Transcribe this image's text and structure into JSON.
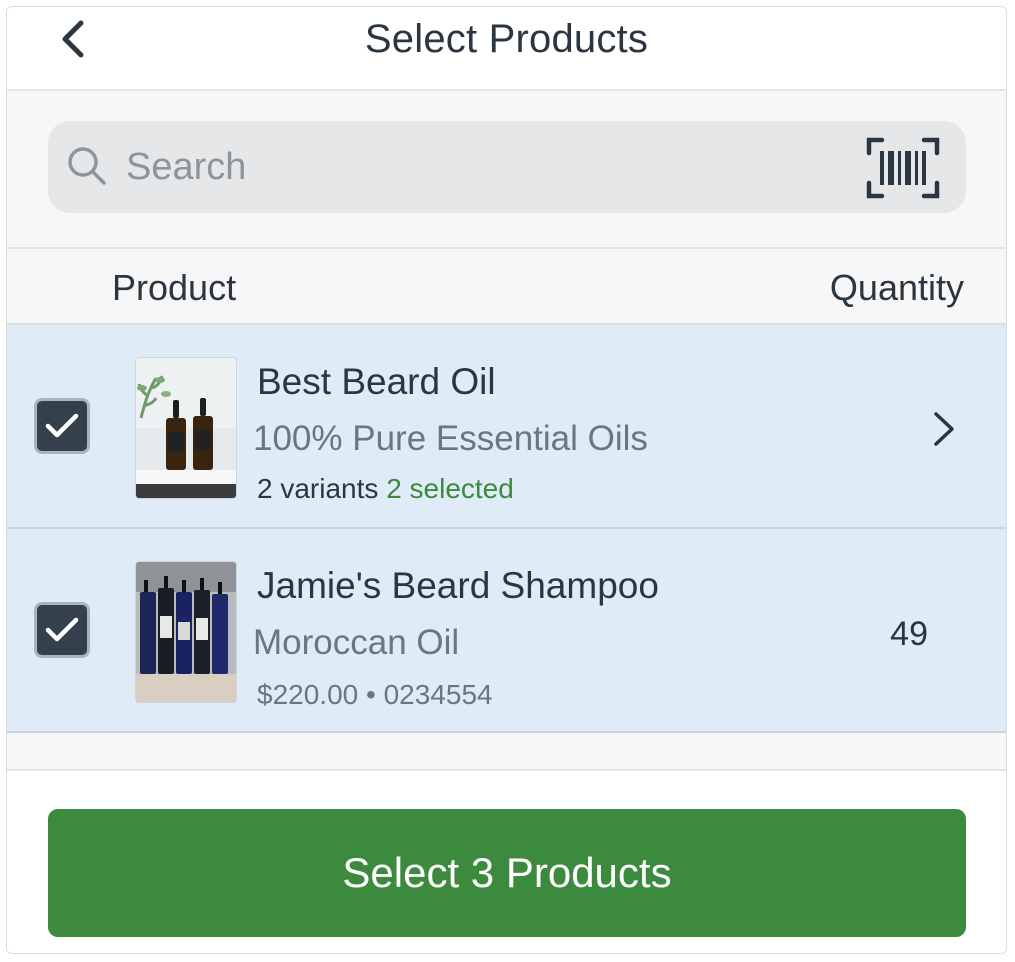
{
  "header": {
    "title": "Select Products"
  },
  "search": {
    "placeholder": "Search"
  },
  "columns": {
    "product": "Product",
    "quantity": "Quantity"
  },
  "products": [
    {
      "name": "Best Beard Oil",
      "subtitle": "100% Pure Essential Oils",
      "variants": "2 variants",
      "selected": "2 selected",
      "checked": true
    },
    {
      "name": "Jamie's Beard Shampoo",
      "subtitle": "Moroccan Oil",
      "price": "$220.00",
      "separator": "•",
      "sku": "0234554",
      "quantity": "49",
      "checked": true
    }
  ],
  "footer": {
    "button_label": "Select 3 Products"
  },
  "colors": {
    "accent_green": "#3b8a3e",
    "row_selected_bg": "#dfebf6",
    "checkbox_bg": "#34414c"
  },
  "icons": [
    "back-chevron-icon",
    "search-icon",
    "barcode-scan-icon",
    "checkmark-icon",
    "chevron-right-icon"
  ]
}
